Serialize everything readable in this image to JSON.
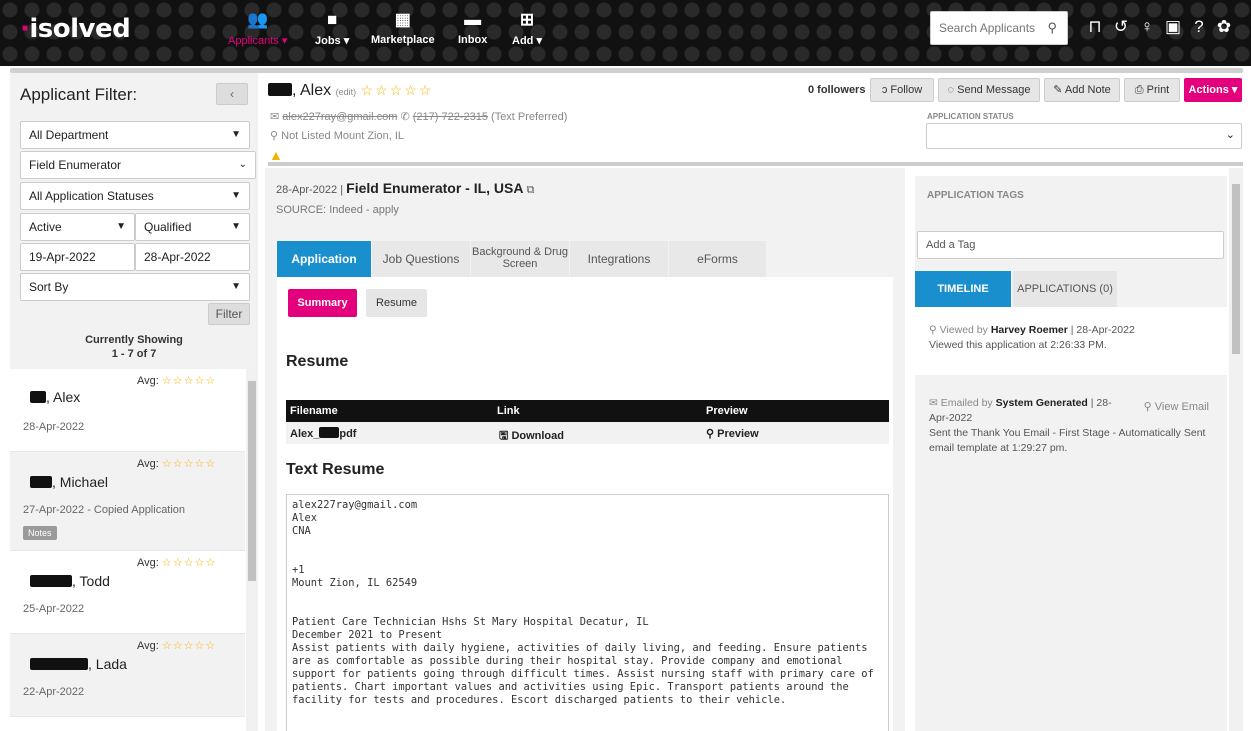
{
  "brand": {
    "name": "isolved",
    "accent": "#e4007c",
    "tab_blue": "#1a8fce"
  },
  "nav": {
    "items": [
      {
        "label": "Applicants",
        "icon": "users-icon",
        "caret": true
      },
      {
        "label": "Jobs",
        "icon": "briefcase-icon",
        "caret": true
      },
      {
        "label": "Marketplace",
        "icon": "store-icon",
        "caret": false
      },
      {
        "label": "Inbox",
        "icon": "chat-icon",
        "caret": false
      },
      {
        "label": "Add",
        "icon": "plus-box-icon",
        "caret": true
      }
    ],
    "search_placeholder": "Search Applicants",
    "right_icons": [
      "bookmark-icon",
      "history-icon",
      "lightbulb-icon",
      "calendar-icon",
      "help-icon",
      "gear-icon"
    ]
  },
  "filter": {
    "title": "Applicant Filter:",
    "collapse": "‹",
    "department": "All Department",
    "job": "Field Enumerator",
    "status": "All Application Statuses",
    "active": "Active",
    "qualified": "Qualified",
    "date_from": "19-Apr-2022",
    "date_to": "28-Apr-2022",
    "sort": "Sort By",
    "filter_button": "Filter",
    "showing_label": "Currently Showing",
    "showing_range": "1 - 7 of 7"
  },
  "applicants": [
    {
      "name": ", Alex",
      "date": "28-Apr-2022",
      "avg": "Avg:",
      "notes": ""
    },
    {
      "name": ", Michael",
      "date": "27-Apr-2022 - Copied Application",
      "avg": "Avg:",
      "notes": "Notes"
    },
    {
      "name": ", Todd",
      "date": "25-Apr-2022",
      "avg": "Avg:",
      "notes": ""
    },
    {
      "name": ", Lada",
      "date": "22-Apr-2022",
      "avg": "Avg:",
      "notes": ""
    }
  ],
  "header": {
    "name": ", Alex",
    "edit": "(edit)",
    "email": "alex227ray@gmail.com",
    "phone": "(217) 722-2315",
    "phone_note": "(Text Preferred)",
    "location": "Not Listed Mount Zion, IL",
    "followers": "0 followers",
    "buttons": {
      "follow": "Follow",
      "send": "Send Message",
      "note": "Add Note",
      "print": "Print",
      "actions": "Actions"
    },
    "status_label": "APPLICATION STATUS",
    "status_value": ""
  },
  "job": {
    "date": "28-Apr-2022",
    "title": "Field Enumerator - IL, USA",
    "source_label": "SOURCE:",
    "source": "Indeed - apply"
  },
  "tabs": [
    "Application",
    "Job Questions",
    "Background & Drug Screen",
    "Integrations",
    "eForms"
  ],
  "subtabs": [
    "Summary",
    "Resume"
  ],
  "resume": {
    "heading": "Resume",
    "columns": [
      "Filename",
      "Link",
      "Preview"
    ],
    "file": {
      "filename_prefix": "Alex_",
      "filename_suffix": "pdf",
      "download": "Download",
      "preview": "Preview"
    },
    "text_heading": "Text Resume",
    "text": "alex227ray@gmail.com\nAlex \nCNA\n\n\n+1 \nMount Zion, IL 62549\n\n\nPatient Care Technician Hshs St Mary Hospital Decatur, IL\nDecember 2021 to Present\nAssist patients with daily hygiene, activities of daily living, and feeding. Ensure patients are as comfortable as possible during their hospital stay. Provide company and emotional support for patients going through difficult times. Assist nursing staff with primary care of patients. Chart important values and activities using Epic. Transport patients around the facility for tests and procedures. Escort discharged patients to their vehicle."
  },
  "right": {
    "tags_label": "APPLICATION TAGS",
    "tag_placeholder": "Add a Tag",
    "tabs": [
      "TIMELINE",
      "APPLICATIONS (0)"
    ],
    "timeline": [
      {
        "action": "Viewed by",
        "who": "Harvey Roemer",
        "date": "28-Apr-2022",
        "detail": "Viewed this application at 2:26:33 PM.",
        "link": ""
      },
      {
        "action": "Emailed by",
        "who": "System Generated",
        "date": "28-Apr-2022",
        "detail": "Sent the Thank You Email - First Stage - Automatically Sent email template at 1:29:27 pm.",
        "link": "View Email"
      }
    ]
  }
}
